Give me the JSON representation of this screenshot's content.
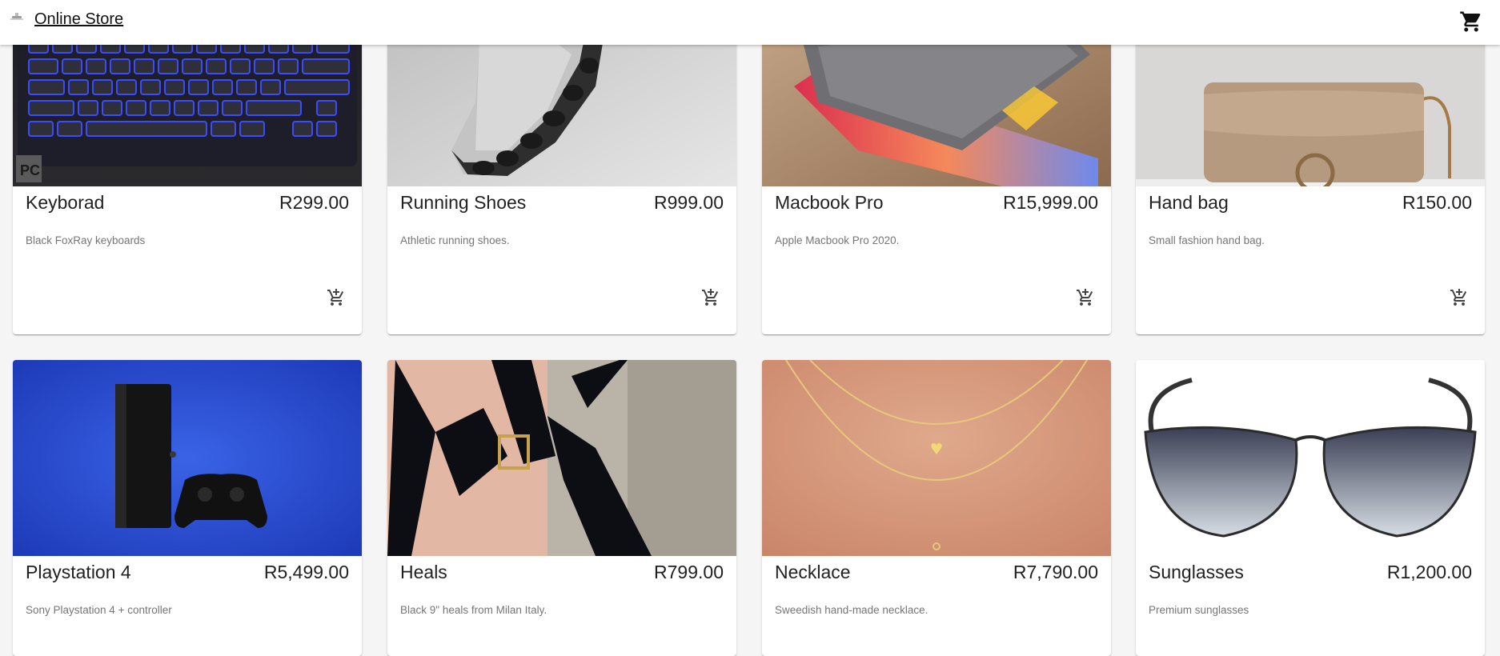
{
  "app": {
    "title": "Online Store",
    "logo_icon": "store-logo-icon",
    "cart_icon": "shopping-cart-icon"
  },
  "products": [
    {
      "name": "Keyborad",
      "price": "R299.00",
      "description": "Black FoxRay keyboards",
      "image": "keyboard-image"
    },
    {
      "name": "Running Shoes",
      "price": "R999.00",
      "description": "Athletic running shoes.",
      "image": "shoe-image"
    },
    {
      "name": "Macbook Pro",
      "price": "R15,999.00",
      "description": "Apple Macbook Pro 2020.",
      "image": "laptop-image"
    },
    {
      "name": "Hand bag",
      "price": "R150.00",
      "description": "Small fashion hand bag.",
      "image": "handbag-image"
    },
    {
      "name": "Playstation 4",
      "price": "R5,499.00",
      "description": "Sony Playstation 4 + controller",
      "image": "console-image"
    },
    {
      "name": "Heals",
      "price": "R799.00",
      "description": "Black 9\" heals from Milan Italy.",
      "image": "heels-image"
    },
    {
      "name": "Necklace",
      "price": "R7,790.00",
      "description": "Sweedish hand-made necklace.",
      "image": "necklace-image"
    },
    {
      "name": "Sunglasses",
      "price": "R1,200.00",
      "description": "Premium sunglasses",
      "image": "sunglasses-image"
    }
  ],
  "colors": {
    "background": "#f5f5f5",
    "card": "#ffffff",
    "text_primary": "#212121",
    "text_secondary": "#757575",
    "console_backdrop": "#2446c9"
  }
}
